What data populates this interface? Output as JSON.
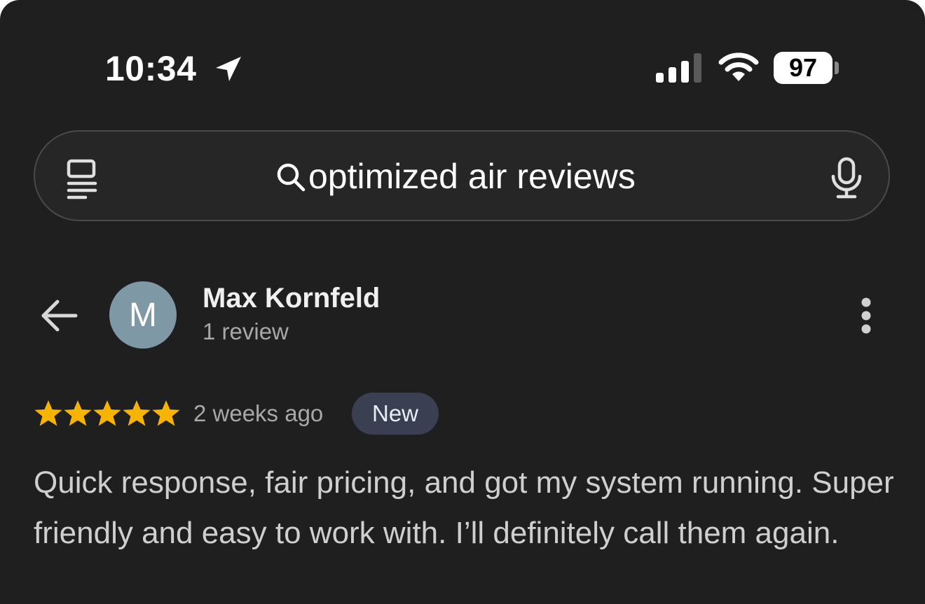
{
  "status_bar": {
    "time": "10:34",
    "battery": "97"
  },
  "search": {
    "query": "optimized air reviews"
  },
  "reviewer": {
    "initial": "M",
    "name": "Max Kornfeld",
    "review_count": "1 review"
  },
  "review": {
    "rating": 5,
    "time_ago": "2 weeks ago",
    "badge": "New",
    "text": "Quick response, fair pricing, and got my system running. Super friendly and easy to work with. I’ll definitely call them again."
  },
  "colors": {
    "background": "#1f1f1f",
    "star": "#f6b400",
    "avatar": "#7f98a6",
    "badge": "#3a3f52"
  }
}
